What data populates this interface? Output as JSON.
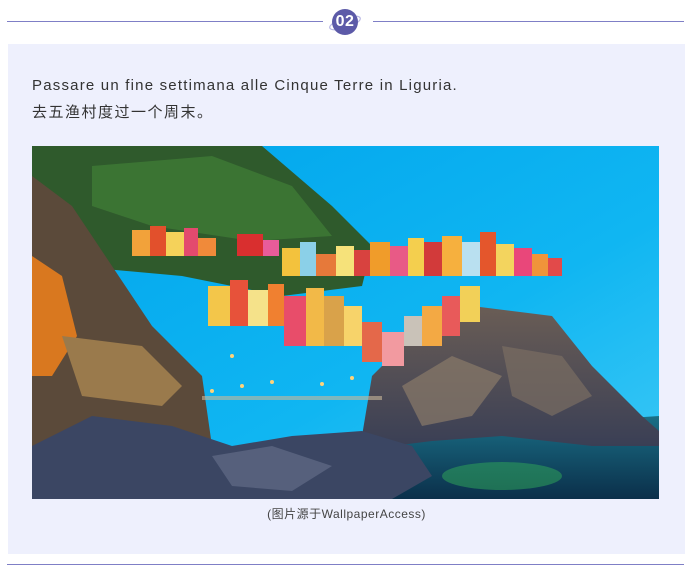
{
  "section": {
    "number": "02"
  },
  "content": {
    "italian": "Passare un fine settimana alle Cinque Terre in Liguria.",
    "chinese": "去五渔村度过一个周末。"
  },
  "figure": {
    "caption": "(图片源于WallpaperAccess)"
  },
  "colors": {
    "accent": "#5c5aa8",
    "line": "#7f7fc6",
    "card_bg": "#eef0fd"
  }
}
